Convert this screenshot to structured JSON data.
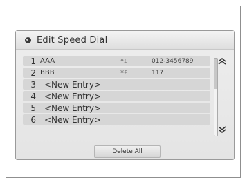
{
  "title": "Edit Speed Dial",
  "entries": [
    {
      "num": "1",
      "name": "AAA",
      "type": "¥£",
      "phone": "012-3456789"
    },
    {
      "num": "2",
      "name": "BBB",
      "type": "¥£",
      "phone": "117"
    },
    {
      "num": "3",
      "name": "<New Entry>"
    },
    {
      "num": "4",
      "name": "<New Entry>"
    },
    {
      "num": "5",
      "name": "<New Entry>"
    },
    {
      "num": "6",
      "name": "<New Entry>"
    }
  ],
  "scroll": {
    "up_glyph": "⌃",
    "down_glyph": "⌄"
  },
  "delete_all_label": "Delete All",
  "colors": {
    "row_bg": "#d6d6d6",
    "screen_bg": "#e9e9e9"
  },
  "icons": [
    "title-bullet-icon",
    "phone-type-icon",
    "scroll-up-icon",
    "scroll-down-icon"
  ]
}
